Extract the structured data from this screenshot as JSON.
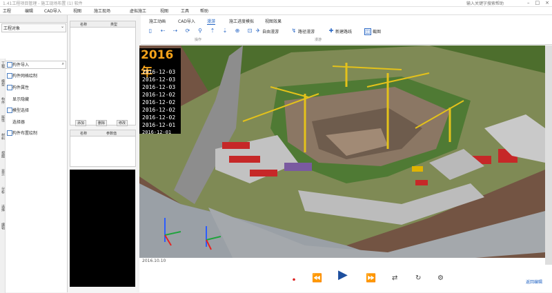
{
  "window": {
    "title": "1.41工程项目管理 - 施工现场布置 (1) 软件",
    "right_text": "输入关键字搜索帮助"
  },
  "menu": [
    "工程",
    "编辑",
    "CAD导入",
    "视图",
    "施工现场",
    "虚拟施工",
    "视图",
    "工具",
    "帮助"
  ],
  "left_panel": {
    "dropdown": "工程对象",
    "items": [
      "构件导入",
      "构件网格绘制",
      "构件属性",
      "显示隐藏",
      "模型选择",
      "选择器",
      "构件布置绘制"
    ]
  },
  "side_tabs": [
    "工程",
    "模型",
    "构件",
    "属性",
    "材料",
    "视图",
    "显示",
    "分析",
    "选择",
    "编辑"
  ],
  "mid_panel": {
    "table1_headers": [
      "名称",
      "类型"
    ],
    "buttons": [
      "添加",
      "删除",
      "修改"
    ],
    "table2_headers": [
      "名称",
      "参数值"
    ]
  },
  "toolbar": {
    "tabs": [
      "施工动画",
      "CAD导入",
      "漫游",
      "施工进度模拟",
      "视图效果"
    ],
    "active_tab": "漫游",
    "tools": [
      "自由漫游",
      "路径漫游",
      "新建路线",
      "截图"
    ],
    "groups": [
      "操作",
      "漫游"
    ]
  },
  "scene": {
    "year": "2016年",
    "dates": [
      "2016-12-03",
      "2016-12-03",
      "2016-12-03",
      "2016-12-02",
      "2016-12-02",
      "2016-12-02",
      "2016-12-02",
      "2016-12-01",
      "2016-12-01"
    ],
    "status": "2016.10.10"
  },
  "playback": {
    "right_link": "返回编辑"
  }
}
